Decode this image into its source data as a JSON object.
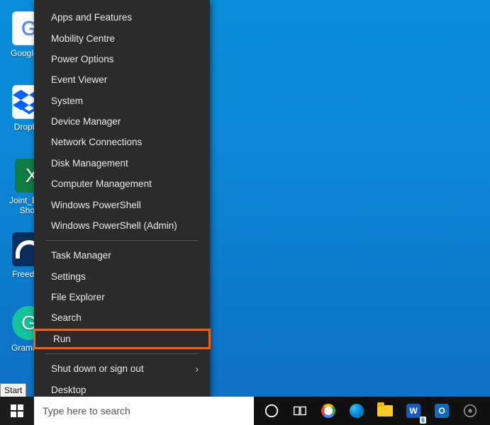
{
  "desktop": {
    "icons": [
      {
        "label": "Google ...",
        "glyph": "G"
      },
      {
        "label": "Dropb...",
        "glyph": "▰"
      },
      {
        "label": "Joint_Bu... - Shor...",
        "glyph": "X"
      },
      {
        "label": "Freedo...",
        "glyph": ""
      },
      {
        "label": "Gramm...",
        "glyph": "G"
      }
    ],
    "start_tooltip": "Start"
  },
  "winx_menu": {
    "group1": [
      "Apps and Features",
      "Mobility Centre",
      "Power Options",
      "Event Viewer",
      "System",
      "Device Manager",
      "Network Connections",
      "Disk Management",
      "Computer Management",
      "Windows PowerShell",
      "Windows PowerShell (Admin)"
    ],
    "group2": [
      "Task Manager",
      "Settings",
      "File Explorer",
      "Search"
    ],
    "run": "Run",
    "group3": [
      "Shut down or sign out",
      "Desktop"
    ]
  },
  "taskbar": {
    "search_placeholder": "Type here to search",
    "word_badge": "6",
    "word_letter": "W",
    "outlook_letter": "O"
  }
}
